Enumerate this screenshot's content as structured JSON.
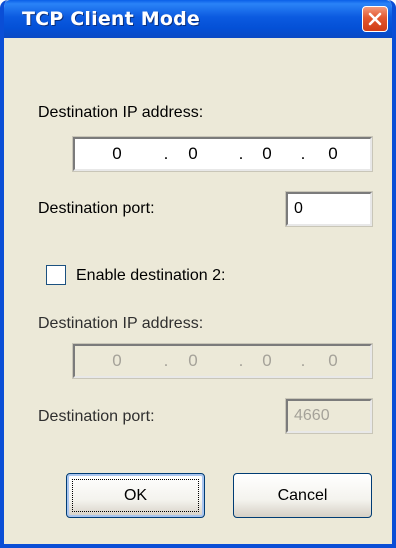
{
  "window": {
    "title": "TCP Client Mode"
  },
  "dest1": {
    "ip_label": "Destination IP address:",
    "ip": [
      "0",
      "0",
      "0",
      "0"
    ],
    "port_label": "Destination port:",
    "port": "0"
  },
  "dest2": {
    "enable_label": "Enable destination 2:",
    "enabled": false,
    "ip_label": "Destination IP address:",
    "ip": [
      "0",
      "0",
      "0",
      "0"
    ],
    "port_label": "Destination port:",
    "port": "4660"
  },
  "ip_separator": ".",
  "buttons": {
    "ok": "OK",
    "cancel": "Cancel"
  },
  "icons": {
    "close": "close-icon"
  },
  "colors": {
    "titlebar": "#0a5fe8",
    "close_button": "#e3582f",
    "dialog_face": "#ece9d8"
  }
}
